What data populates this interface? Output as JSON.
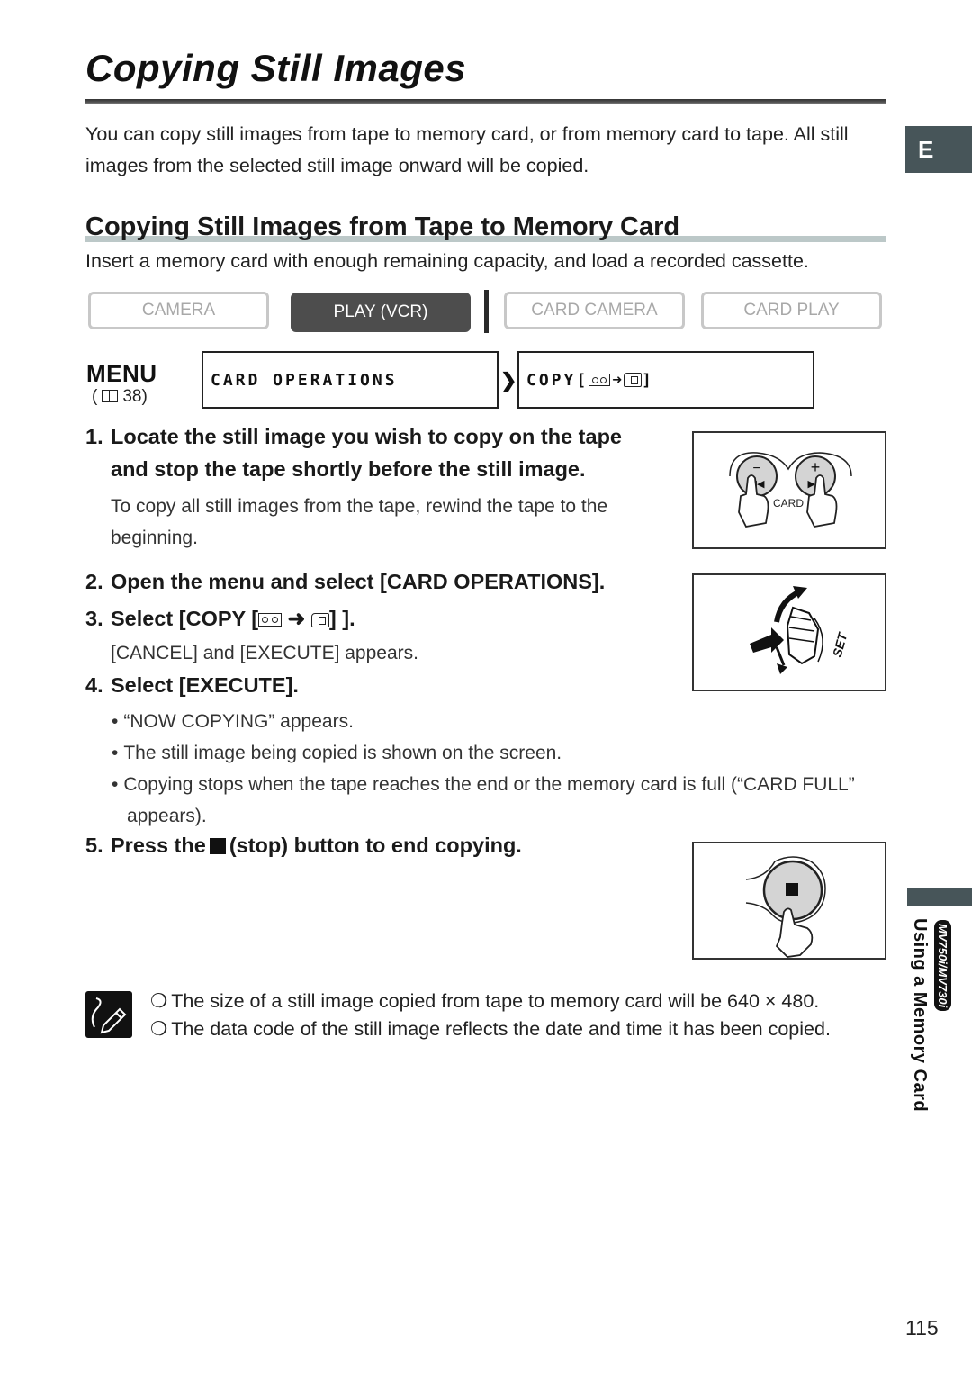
{
  "page": {
    "title": "Copying Still Images",
    "intro": "You can copy still images from tape to memory card, or from memory card to tape. All still images from the selected still image onward will be copied.",
    "language_tab": "E",
    "page_number": "115"
  },
  "section": {
    "title": "Copying Still Images from Tape to Memory Card",
    "prerequisite": "Insert a memory card with enough remaining capacity, and load a recorded cassette."
  },
  "modes": [
    {
      "label": "CAMERA",
      "active": false
    },
    {
      "label": "PLAY (VCR)",
      "active": true
    },
    {
      "label": "CARD CAMERA",
      "active": false
    },
    {
      "label": "CARD PLAY",
      "active": false
    }
  ],
  "menu": {
    "label": "MENU",
    "ref_open": "(",
    "ref_page": "38)",
    "path": [
      "CARD OPERATIONS",
      "COPY["
    ],
    "path_suffix": "]"
  },
  "steps": [
    {
      "num": "1.",
      "line1": "Locate the still image you wish to copy on the tape",
      "line2": "and stop the tape shortly before the still image.",
      "note": "To copy all still images from the tape, rewind the tape to the beginning."
    },
    {
      "num": "2.",
      "text": "Open the menu and select [CARD OPERATIONS]."
    },
    {
      "num": "3.",
      "text_prefix": "Select [COPY [",
      "text_suffix": "] ].",
      "note": "[CANCEL] and [EXECUTE] appears."
    },
    {
      "num": "4.",
      "text": "Select [EXECUTE].",
      "bullets": [
        "“NOW COPYING” appears.",
        "The still image being copied is shown on the screen.",
        "Copying stops when the tape reaches the end or the memory card is full (“CARD FULL” appears)."
      ]
    },
    {
      "num": "5.",
      "text_prefix": "Press the",
      "text_suffix": "(stop) button to end copying."
    }
  ],
  "figures": {
    "search_buttons": {
      "minus": "−",
      "plus": "+",
      "label": "CARD"
    },
    "dial": {
      "label": "SET"
    }
  },
  "memo": [
    "The size of a still image copied from tape to memory card will be 640 × 480.",
    "The data code of the still image reflects the date and time it has been copied."
  ],
  "sidebar": {
    "chapter": "Using a Memory Card",
    "models": "MV750i/MV730i"
  }
}
